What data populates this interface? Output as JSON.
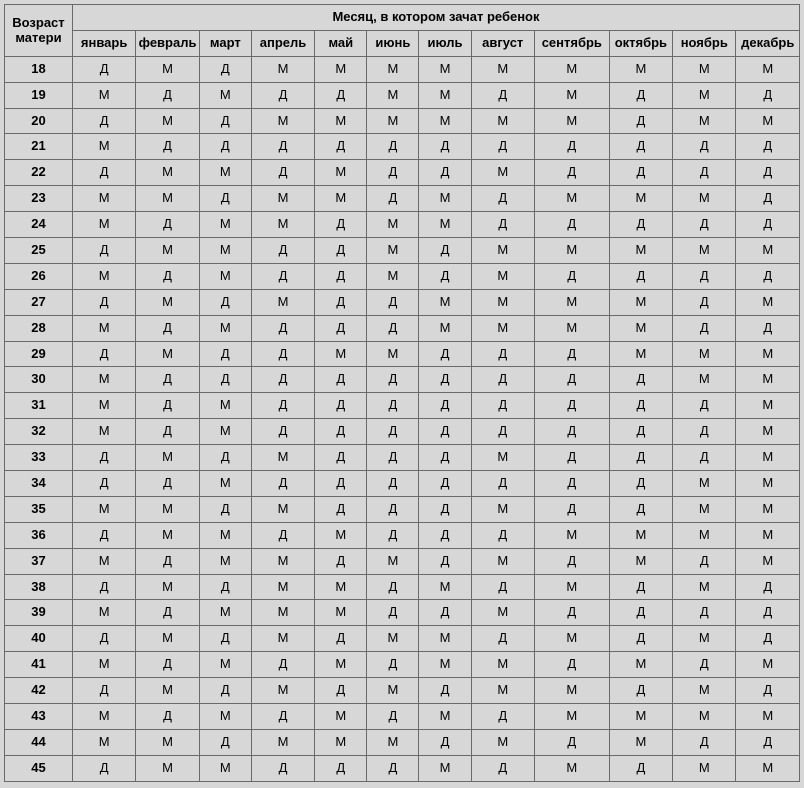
{
  "headers": {
    "age": "Возраст матери",
    "main": "Месяц, в котором зачат ребенок",
    "months": [
      "январь",
      "февраль",
      "март",
      "апрель",
      "май",
      "июнь",
      "июль",
      "август",
      "сентябрь",
      "октябрь",
      "ноябрь",
      "декабрь"
    ]
  },
  "rows": [
    {
      "age": "18",
      "v": [
        "Д",
        "М",
        "Д",
        "М",
        "М",
        "М",
        "М",
        "М",
        "М",
        "М",
        "М",
        "М"
      ]
    },
    {
      "age": "19",
      "v": [
        "М",
        "Д",
        "М",
        "Д",
        "Д",
        "М",
        "М",
        "Д",
        "М",
        "Д",
        "М",
        "Д"
      ]
    },
    {
      "age": "20",
      "v": [
        "Д",
        "М",
        "Д",
        "М",
        "М",
        "М",
        "М",
        "М",
        "М",
        "Д",
        "М",
        "М"
      ]
    },
    {
      "age": "21",
      "v": [
        "М",
        "Д",
        "Д",
        "Д",
        "Д",
        "Д",
        "Д",
        "Д",
        "Д",
        "Д",
        "Д",
        "Д"
      ]
    },
    {
      "age": "22",
      "v": [
        "Д",
        "М",
        "М",
        "Д",
        "М",
        "Д",
        "Д",
        "М",
        "Д",
        "Д",
        "Д",
        "Д"
      ]
    },
    {
      "age": "23",
      "v": [
        "М",
        "М",
        "Д",
        "М",
        "М",
        "Д",
        "М",
        "Д",
        "М",
        "М",
        "М",
        "Д"
      ]
    },
    {
      "age": "24",
      "v": [
        "М",
        "Д",
        "М",
        "М",
        "Д",
        "М",
        "М",
        "Д",
        "Д",
        "Д",
        "Д",
        "Д"
      ]
    },
    {
      "age": "25",
      "v": [
        "Д",
        "М",
        "М",
        "Д",
        "Д",
        "М",
        "Д",
        "М",
        "М",
        "М",
        "М",
        "М"
      ]
    },
    {
      "age": "26",
      "v": [
        "М",
        "Д",
        "М",
        "Д",
        "Д",
        "М",
        "Д",
        "М",
        "Д",
        "Д",
        "Д",
        "Д"
      ]
    },
    {
      "age": "27",
      "v": [
        "Д",
        "М",
        "Д",
        "М",
        "Д",
        "Д",
        "М",
        "М",
        "М",
        "М",
        "Д",
        "М"
      ]
    },
    {
      "age": "28",
      "v": [
        "М",
        "Д",
        "М",
        "Д",
        "Д",
        "Д",
        "М",
        "М",
        "М",
        "М",
        "Д",
        "Д"
      ]
    },
    {
      "age": "29",
      "v": [
        "Д",
        "М",
        "Д",
        "Д",
        "М",
        "М",
        "Д",
        "Д",
        "Д",
        "М",
        "М",
        "М"
      ]
    },
    {
      "age": "30",
      "v": [
        "М",
        "Д",
        "Д",
        "Д",
        "Д",
        "Д",
        "Д",
        "Д",
        "Д",
        "Д",
        "М",
        "М"
      ]
    },
    {
      "age": "31",
      "v": [
        "М",
        "Д",
        "М",
        "Д",
        "Д",
        "Д",
        "Д",
        "Д",
        "Д",
        "Д",
        "Д",
        "М"
      ]
    },
    {
      "age": "32",
      "v": [
        "М",
        "Д",
        "М",
        "Д",
        "Д",
        "Д",
        "Д",
        "Д",
        "Д",
        "Д",
        "Д",
        "М"
      ]
    },
    {
      "age": "33",
      "v": [
        "Д",
        "М",
        "Д",
        "М",
        "Д",
        "Д",
        "Д",
        "М",
        "Д",
        "Д",
        "Д",
        "М"
      ]
    },
    {
      "age": "34",
      "v": [
        "Д",
        "Д",
        "М",
        "Д",
        "Д",
        "Д",
        "Д",
        "Д",
        "Д",
        "Д",
        "М",
        "М"
      ]
    },
    {
      "age": "35",
      "v": [
        "М",
        "М",
        "Д",
        "М",
        "Д",
        "Д",
        "Д",
        "М",
        "Д",
        "Д",
        "М",
        "М"
      ]
    },
    {
      "age": "36",
      "v": [
        "Д",
        "М",
        "М",
        "Д",
        "М",
        "Д",
        "Д",
        "Д",
        "М",
        "М",
        "М",
        "М"
      ]
    },
    {
      "age": "37",
      "v": [
        "М",
        "Д",
        "М",
        "М",
        "Д",
        "М",
        "Д",
        "М",
        "Д",
        "М",
        "Д",
        "М"
      ]
    },
    {
      "age": "38",
      "v": [
        "Д",
        "М",
        "Д",
        "М",
        "М",
        "Д",
        "М",
        "Д",
        "М",
        "Д",
        "М",
        "Д"
      ]
    },
    {
      "age": "39",
      "v": [
        "М",
        "Д",
        "М",
        "М",
        "М",
        "Д",
        "Д",
        "М",
        "Д",
        "Д",
        "Д",
        "Д"
      ]
    },
    {
      "age": "40",
      "v": [
        "Д",
        "М",
        "Д",
        "М",
        "Д",
        "М",
        "М",
        "Д",
        "М",
        "Д",
        "М",
        "Д"
      ]
    },
    {
      "age": "41",
      "v": [
        "М",
        "Д",
        "М",
        "Д",
        "М",
        "Д",
        "М",
        "М",
        "Д",
        "М",
        "Д",
        "М"
      ]
    },
    {
      "age": "42",
      "v": [
        "Д",
        "М",
        "Д",
        "М",
        "Д",
        "М",
        "Д",
        "М",
        "М",
        "Д",
        "М",
        "Д"
      ]
    },
    {
      "age": "43",
      "v": [
        "М",
        "Д",
        "М",
        "Д",
        "М",
        "Д",
        "М",
        "Д",
        "М",
        "М",
        "М",
        "М"
      ]
    },
    {
      "age": "44",
      "v": [
        "М",
        "М",
        "Д",
        "М",
        "М",
        "М",
        "Д",
        "М",
        "Д",
        "М",
        "Д",
        "Д"
      ]
    },
    {
      "age": "45",
      "v": [
        "Д",
        "М",
        "М",
        "Д",
        "Д",
        "Д",
        "М",
        "Д",
        "М",
        "Д",
        "М",
        "М"
      ]
    }
  ]
}
